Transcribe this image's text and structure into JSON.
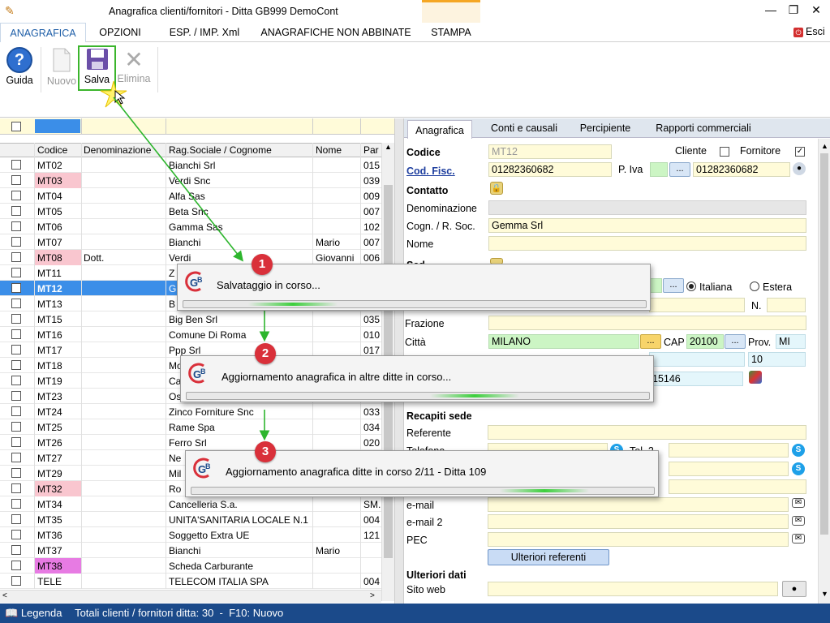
{
  "window": {
    "title": "Anagrafica clienti/fornitori - Ditta GB999 DemoCont"
  },
  "menu": {
    "items": [
      "ANAGRAFICA",
      "OPZIONI",
      "ESP. / IMP. Xml",
      "ANAGRAFICHE NON ABBINATE",
      "STAMPA"
    ],
    "exit_label": "Esci"
  },
  "toolbar": {
    "guida": "Guida",
    "nuovo": "Nuovo",
    "salva": "Salva",
    "elimina": "Elimina"
  },
  "grid": {
    "columns": [
      "Codice",
      "Denominazione",
      "Rag.Sociale / Cognome",
      "Nome",
      "Par"
    ],
    "rows": [
      {
        "code": "MT02",
        "den": "",
        "rag": "Bianchi Srl",
        "nome": "",
        "par": "015",
        "style": "normal"
      },
      {
        "code": "MT03",
        "den": "",
        "rag": "Verdi Snc",
        "nome": "",
        "par": "039",
        "style": "pink"
      },
      {
        "code": "MT04",
        "den": "",
        "rag": "Alfa Sas",
        "nome": "",
        "par": "009",
        "style": "normal"
      },
      {
        "code": "MT05",
        "den": "",
        "rag": "Beta Snc",
        "nome": "",
        "par": "007",
        "style": "normal"
      },
      {
        "code": "MT06",
        "den": "",
        "rag": "Gamma Sas",
        "nome": "",
        "par": "102",
        "style": "normal"
      },
      {
        "code": "MT07",
        "den": "",
        "rag": "Bianchi",
        "nome": "Mario",
        "par": "007",
        "style": "normal"
      },
      {
        "code": "MT08",
        "den": "Dott.",
        "rag": "Verdi",
        "nome": "Giovanni",
        "par": "006",
        "style": "pink"
      },
      {
        "code": "MT11",
        "den": "",
        "rag": "Z",
        "nome": "",
        "par": "",
        "style": "normal"
      },
      {
        "code": "MT12",
        "den": "",
        "rag": "G",
        "nome": "",
        "par": "",
        "style": "selected"
      },
      {
        "code": "MT13",
        "den": "",
        "rag": "B",
        "nome": "",
        "par": "",
        "style": "normal"
      },
      {
        "code": "MT15",
        "den": "",
        "rag": "Big Ben Srl",
        "nome": "",
        "par": "035",
        "style": "normal"
      },
      {
        "code": "MT16",
        "den": "",
        "rag": "Comune Di Roma",
        "nome": "",
        "par": "010",
        "style": "normal"
      },
      {
        "code": "MT17",
        "den": "",
        "rag": "Ppp Srl",
        "nome": "",
        "par": "017",
        "style": "normal"
      },
      {
        "code": "MT18",
        "den": "",
        "rag": "Mo",
        "nome": "",
        "par": "",
        "style": "normal"
      },
      {
        "code": "MT19",
        "den": "",
        "rag": "Ca",
        "nome": "",
        "par": "",
        "style": "normal"
      },
      {
        "code": "MT23",
        "den": "",
        "rag": "Os",
        "nome": "",
        "par": "",
        "style": "normal"
      },
      {
        "code": "MT24",
        "den": "",
        "rag": "Zinco Forniture Snc",
        "nome": "",
        "par": "033",
        "style": "normal"
      },
      {
        "code": "MT25",
        "den": "",
        "rag": "Rame Spa",
        "nome": "",
        "par": "034",
        "style": "normal"
      },
      {
        "code": "MT26",
        "den": "",
        "rag": "Ferro Srl",
        "nome": "",
        "par": "020",
        "style": "normal"
      },
      {
        "code": "MT27",
        "den": "",
        "rag": "Ne",
        "nome": "",
        "par": "",
        "style": "normal"
      },
      {
        "code": "MT29",
        "den": "",
        "rag": "Mil",
        "nome": "",
        "par": "",
        "style": "normal"
      },
      {
        "code": "MT32",
        "den": "",
        "rag": "Ro",
        "nome": "",
        "par": "",
        "style": "pink"
      },
      {
        "code": "MT34",
        "den": "",
        "rag": "Cancelleria S.a.",
        "nome": "",
        "par": "SM.",
        "style": "normal"
      },
      {
        "code": "MT35",
        "den": "",
        "rag": "UNITA'SANITARIA LOCALE N.1",
        "nome": "",
        "par": "004",
        "style": "normal"
      },
      {
        "code": "MT36",
        "den": "",
        "rag": "Soggetto Extra UE",
        "nome": "",
        "par": "121",
        "style": "normal"
      },
      {
        "code": "MT37",
        "den": "",
        "rag": "Bianchi",
        "nome": "Mario",
        "par": "",
        "style": "normal"
      },
      {
        "code": "MT38",
        "den": "",
        "rag": "Scheda Carburante",
        "nome": "",
        "par": "",
        "style": "magenta"
      },
      {
        "code": "TELE",
        "den": "",
        "rag": "TELECOM ITALIA SPA",
        "nome": "",
        "par": "004",
        "style": "normal"
      }
    ]
  },
  "tabs": [
    "Anagrafica",
    "Conti e causali",
    "Percipiente",
    "Rapporti commerciali"
  ],
  "form": {
    "codice_label": "Codice",
    "codice": "MT12",
    "cliente_label": "Cliente",
    "fornitore_label": "Fornitore",
    "codfisc_label": "Cod. Fisc.",
    "codfisc": "01282360682",
    "piva_label": "P. Iva",
    "piva": "01282360682",
    "contatto_label": "Contatto",
    "denominazione_label": "Denominazione",
    "cognome_label": "Cogn. / R. Soc.",
    "cognome": "Gemma Srl",
    "nome_label": "Nome",
    "sede_partial": "Sed",
    "italiana": "Italiana",
    "estera": "Estera",
    "n_label": "N.",
    "frazione_label": "Frazione",
    "citta_label": "Città",
    "citta": "MILANO",
    "cap_label": "CAP",
    "cap": "20100",
    "prov_label": "Prov.",
    "prov": "MI",
    "civico": "10",
    "phone_partial": "15146",
    "recapiti_label": "Recapiti sede",
    "referente_label": "Referente",
    "telefono_label": "Telefono",
    "tel2_label": "Tel. 2",
    "email_label": "e-mail",
    "email2_label": "e-mail 2",
    "pec_label": "PEC",
    "ulteriori_ref_btn": "Ulteriori referenti",
    "ulteriori_label": "Ulteriori dati",
    "sito_label": "Sito web"
  },
  "dialogs": [
    {
      "num": "1",
      "text": "Salvataggio in corso..."
    },
    {
      "num": "2",
      "text": "Aggiornamento anagrafica in altre ditte in corso..."
    },
    {
      "num": "3",
      "text": "Aggiornamento anagrafica ditte in corso 2/11 - Ditta 109"
    }
  ],
  "status": {
    "legenda": "Legenda",
    "text": "Totali clienti / fornitori ditta: 30  -  F10: Nuovo"
  }
}
